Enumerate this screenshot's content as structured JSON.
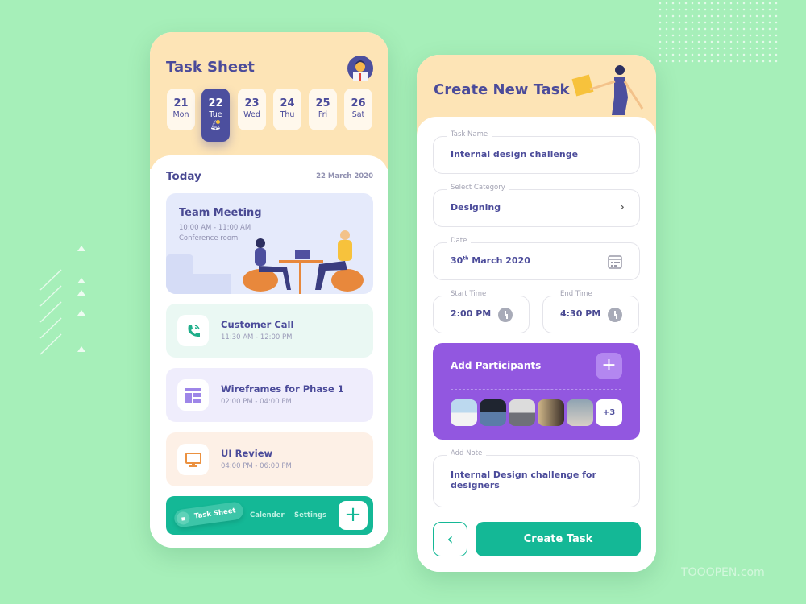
{
  "task_sheet": {
    "title": "Task Sheet",
    "days": [
      {
        "num": "21",
        "day": "Mon"
      },
      {
        "num": "22",
        "day": "Tue"
      },
      {
        "num": "23",
        "day": "Wed"
      },
      {
        "num": "24",
        "day": "Thu"
      },
      {
        "num": "25",
        "day": "Fri"
      },
      {
        "num": "26",
        "day": "Sat"
      }
    ],
    "selected_day": "22",
    "today_label": "Today",
    "today_date": "22 March 2020",
    "meeting": {
      "title": "Team Meeting",
      "time": "10:00 AM - 11:00 AM",
      "place": "Conference room"
    },
    "tasks": [
      {
        "title": "Customer Call",
        "time": "11:30 AM - 12:00 PM",
        "icon": "phone-icon",
        "color": "#eaf8f3"
      },
      {
        "title": "Wireframes for Phase 1",
        "time": "02:00 PM - 04:00 PM",
        "icon": "layout-icon",
        "color": "#efedfc"
      },
      {
        "title": "UI Review",
        "time": "04:00 PM - 06:00 PM",
        "icon": "monitor-icon",
        "color": "#fdf0e6"
      }
    ],
    "nav": {
      "task_sheet": "Task Sheet",
      "calender": "Calender",
      "settings": "Settings",
      "add": "+"
    }
  },
  "create_task": {
    "title": "Create New Task",
    "task_name": {
      "label": "Task Name",
      "value": "Internal design challenge"
    },
    "category": {
      "label": "Select Category",
      "value": "Designing"
    },
    "date": {
      "label": "Date",
      "value_day": "30",
      "value_sup": "th",
      "value_rest": " March 2020"
    },
    "start_time": {
      "label": "Start Time",
      "value": "2:00 PM"
    },
    "end_time": {
      "label": "End Time",
      "value": "4:30 PM"
    },
    "participants": {
      "label": "Add Participants",
      "more": "+3"
    },
    "note": {
      "label": "Add Note",
      "value": "Internal Design challenge for designers"
    },
    "create_button": "Create Task"
  },
  "watermark": "TOOOPEN.com",
  "colors": {
    "background": "#a6efb9",
    "header": "#fde4b6",
    "primary": "#4b4b9a",
    "green": "#14b896",
    "purple": "#9257e0"
  }
}
